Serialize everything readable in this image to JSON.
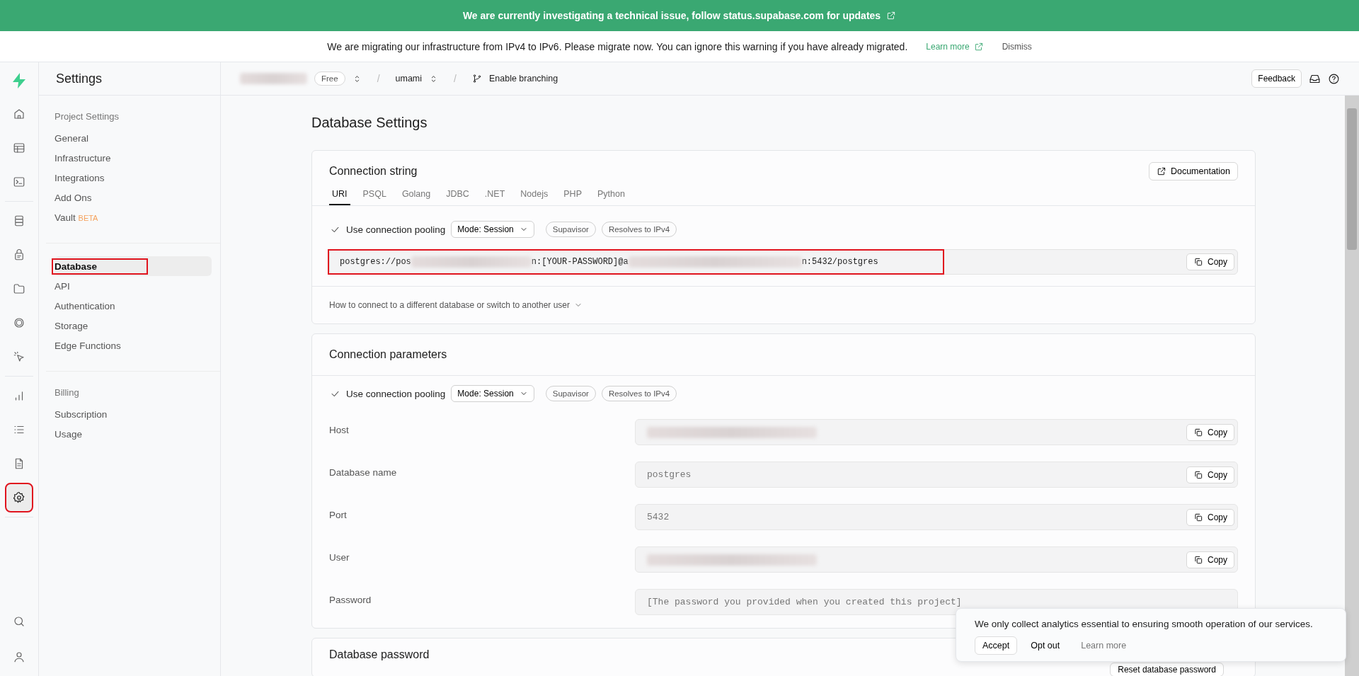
{
  "banner": {
    "text": "We are currently investigating a technical issue, follow status.supabase.com for updates"
  },
  "notice": {
    "text": "We are migrating our infrastructure from IPv4 to IPv6. Please migrate now. You can ignore this warning if you have already migrated.",
    "link": "Learn more",
    "dismiss": "Dismiss"
  },
  "rail": {
    "groups": [
      [
        {
          "selected": false,
          "highlighted": false
        },
        {
          "selected": false,
          "highlighted": false
        },
        {
          "selected": false,
          "highlighted": false
        }
      ],
      [
        {
          "selected": false,
          "highlighted": false
        },
        {
          "selected": false,
          "highlighted": false
        },
        {
          "selected": false,
          "highlighted": false
        },
        {
          "selected": false,
          "highlighted": false
        },
        {
          "selected": false,
          "highlighted": false
        }
      ],
      [
        {
          "selected": false,
          "highlighted": false
        },
        {
          "selected": false,
          "highlighted": false
        },
        {
          "selected": false,
          "highlighted": false
        },
        {
          "selected": true,
          "highlighted": true
        }
      ]
    ],
    "bottom": [
      {
        "selected": false,
        "highlighted": false
      },
      {
        "selected": false,
        "highlighted": false
      }
    ]
  },
  "sidebar": {
    "title": "Settings",
    "sections": [
      {
        "heading": "Project Settings",
        "items": [
          {
            "label": "General",
            "selected": false,
            "highlighted": false
          },
          {
            "label": "Infrastructure",
            "selected": false,
            "highlighted": false
          },
          {
            "label": "Integrations",
            "selected": false,
            "highlighted": false
          },
          {
            "label": "Add Ons",
            "selected": false,
            "highlighted": false
          },
          {
            "label": "Vault",
            "badge": "BETA",
            "selected": false,
            "highlighted": false
          }
        ]
      },
      {
        "items": [
          {
            "label": "Database",
            "selected": true,
            "highlighted": true
          },
          {
            "label": "API",
            "selected": false,
            "highlighted": false
          },
          {
            "label": "Authentication",
            "selected": false,
            "highlighted": false
          },
          {
            "label": "Storage",
            "selected": false,
            "highlighted": false
          },
          {
            "label": "Edge Functions",
            "selected": false,
            "highlighted": false
          }
        ]
      },
      {
        "heading": "Billing",
        "items": [
          {
            "label": "Subscription",
            "selected": false,
            "highlighted": false
          },
          {
            "label": "Usage",
            "selected": false,
            "highlighted": false
          }
        ]
      }
    ]
  },
  "topbar": {
    "organization_redacted": true,
    "plan": "Free",
    "separators": [
      "/",
      "/"
    ],
    "project": "umami",
    "branching": "Enable branching",
    "feedback": "Feedback"
  },
  "page": {
    "title": "Database Settings"
  },
  "connection_string": {
    "title": "Connection string",
    "documentation": "Documentation",
    "tabs": [
      {
        "label": "URI",
        "selected": true
      },
      {
        "label": "PSQL",
        "selected": false
      },
      {
        "label": "Golang",
        "selected": false
      },
      {
        "label": "JDBC",
        "selected": false
      },
      {
        "label": ".NET",
        "selected": false
      },
      {
        "label": "Nodejs",
        "selected": false
      },
      {
        "label": "PHP",
        "selected": false
      },
      {
        "label": "Python",
        "selected": false
      }
    ],
    "pooling": {
      "label": "Use connection pooling",
      "checked": true,
      "mode": "Mode: Session",
      "tags": [
        "Supavisor",
        "Resolves to IPv4"
      ]
    },
    "uri": {
      "highlighted": true,
      "parts": [
        {
          "kind": "text",
          "text": "postgres://pos"
        },
        {
          "kind": "redacted"
        },
        {
          "kind": "text",
          "text": "n:[YOUR-PASSWORD]@a"
        },
        {
          "kind": "redacted"
        },
        {
          "kind": "text",
          "text": "n:5432/postgres"
        }
      ],
      "copy": "Copy"
    },
    "help": "How to connect to a different database or switch to another user"
  },
  "connection_parameters": {
    "title": "Connection parameters",
    "pooling": {
      "label": "Use connection pooling",
      "checked": true,
      "mode": "Mode: Session",
      "tags": [
        "Supavisor",
        "Resolves to IPv4"
      ]
    },
    "fields": [
      {
        "label": "Host",
        "redacted": true,
        "copy": "Copy"
      },
      {
        "label": "Database name",
        "value": "postgres",
        "copy": "Copy"
      },
      {
        "label": "Port",
        "value": "5432",
        "copy": "Copy"
      },
      {
        "label": "User",
        "redacted": true,
        "copy": "Copy"
      },
      {
        "label": "Password",
        "value": "[The password you provided when you created this project]"
      }
    ]
  },
  "database_password": {
    "title": "Database password",
    "reset": "Reset database password"
  },
  "cookie_notice": {
    "text": "We only collect analytics essential to ensuring smooth operation of our services.",
    "accept": "Accept",
    "opt_out": "Opt out",
    "learn_more": "Learn more"
  }
}
